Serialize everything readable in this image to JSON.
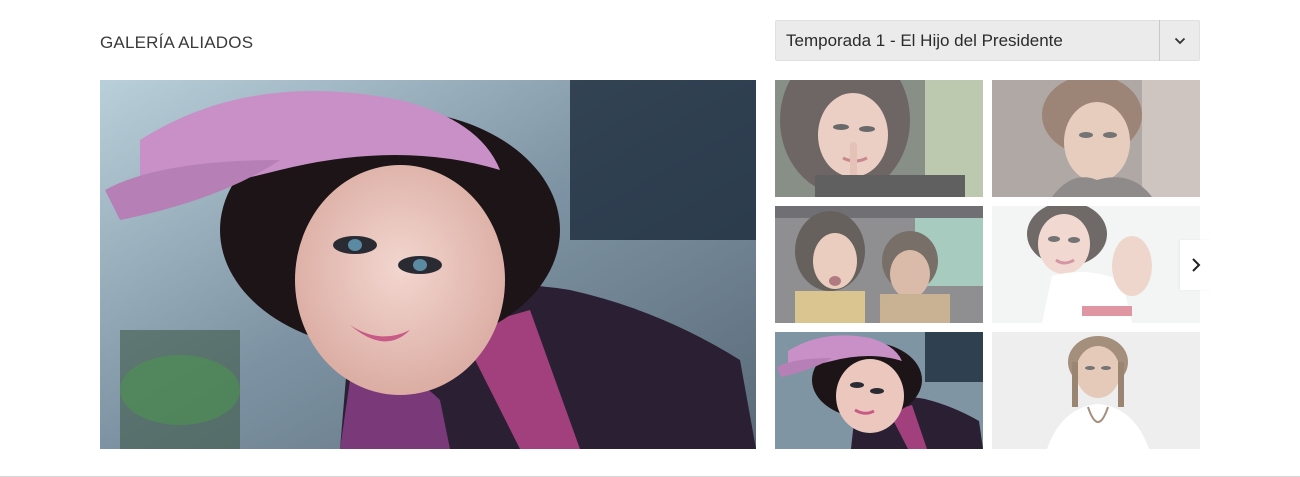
{
  "gallery": {
    "title": "GALERÍA ALIADOS"
  },
  "season_select": {
    "selected": "Temporada 1 - El Hijo del Presidente",
    "icon": "chevron-down-icon"
  },
  "main_photo": {
    "subject": "woman-pink-cap"
  },
  "thumbnails": [
    {
      "subject": "woman-finger-lips",
      "state": "dim"
    },
    {
      "subject": "man-hoodie",
      "state": "dim"
    },
    {
      "subject": "woman-man-car",
      "state": "dim"
    },
    {
      "subject": "woman-white-tank",
      "state": "dim"
    },
    {
      "subject": "woman-pink-cap",
      "state": "active"
    },
    {
      "subject": "man-white-shirt",
      "state": "dim"
    }
  ],
  "carousel": {
    "next_icon": "chevron-right-icon"
  },
  "colors": {
    "select_bg": "#ebebeb",
    "title_text": "#3a3a3a",
    "accent_pink": "#c25a9c"
  }
}
